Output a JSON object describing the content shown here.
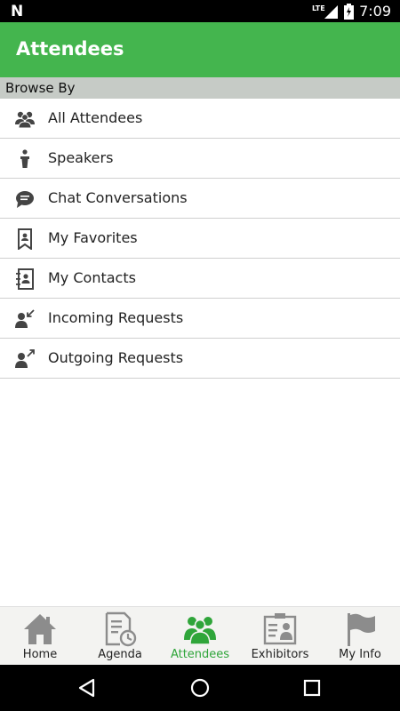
{
  "status_bar": {
    "carrier_icon": "n-icon",
    "network": "LTE",
    "time": "7:09"
  },
  "app_bar": {
    "title": "Attendees"
  },
  "section": {
    "label": "Browse By"
  },
  "menu": {
    "items": [
      {
        "label": "All Attendees",
        "icon": "group-icon"
      },
      {
        "label": "Speakers",
        "icon": "podium-icon"
      },
      {
        "label": "Chat Conversations",
        "icon": "chat-bubble-icon"
      },
      {
        "label": "My Favorites",
        "icon": "bookmark-person-icon"
      },
      {
        "label": "My Contacts",
        "icon": "address-book-icon"
      },
      {
        "label": "Incoming Requests",
        "icon": "person-incoming-icon"
      },
      {
        "label": "Outgoing Requests",
        "icon": "person-outgoing-icon"
      }
    ]
  },
  "tabs": [
    {
      "label": "Home",
      "icon": "home-icon",
      "active": false
    },
    {
      "label": "Agenda",
      "icon": "agenda-icon",
      "active": false
    },
    {
      "label": "Attendees",
      "icon": "attendees-icon",
      "active": true
    },
    {
      "label": "Exhibitors",
      "icon": "exhibitors-icon",
      "active": false
    },
    {
      "label": "My Info",
      "icon": "flag-icon",
      "active": false
    }
  ],
  "colors": {
    "accent": "#44b54e",
    "active_tab": "#2fa53a",
    "icon_gray": "#444444",
    "tab_icon_gray": "#8c8c8c"
  }
}
